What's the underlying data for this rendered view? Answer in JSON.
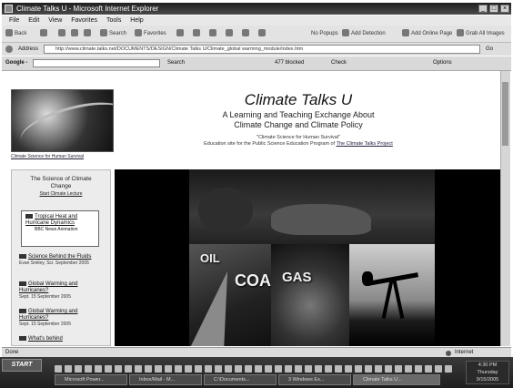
{
  "window": {
    "title": "Climate Talks U - Microsoft Internet Explorer"
  },
  "menu": [
    "File",
    "Edit",
    "View",
    "Favorites",
    "Tools",
    "Help"
  ],
  "toolbar": {
    "back_label": "Back",
    "search_label": "Search",
    "favorites_label": "Favorites",
    "no_popups_label": "No Popups",
    "add_detection_label": "Add Detection",
    "add_online_page_label": "Add Online Page",
    "grab_label": "Grab All Images"
  },
  "address": {
    "label": "Address",
    "url": "http://www.climate.talks.net/DOCUMENTS/DESIGN/Climate Talks U/Climate_global warming_module/index.htm",
    "go_label": "Go"
  },
  "google": {
    "label": "Google -",
    "search_label": "Search",
    "blocked_label": "477 blocked",
    "check_label": "Check",
    "options_label": "Options"
  },
  "page": {
    "site_title": "Climate Talks U",
    "subtitle_1": "A Learning and Teaching Exchange About",
    "subtitle_2": "Climate Change and Climate Policy",
    "small_1": "\"Climate Science for Human Survival\"",
    "small_2": "Education site for the Public Science Education Program of",
    "small_link": "The Climate Talks Project",
    "earth_caption": "Climate Science for Human Survival"
  },
  "sidebar": {
    "heading_1": "The Science of Climate",
    "heading_2": "Change",
    "heading_link": "Start Climate Lecture",
    "box": {
      "title": "Tropical Heat and Hurricane Dynamics",
      "meta": "BBC News Animation"
    },
    "items": [
      {
        "title": "Science Behind the Fluids",
        "meta": "Evan Smiley, Sci. September 2005"
      },
      {
        "title": "Global Warming and Hurricanes?",
        "meta": "Sept. 15 September 2005"
      },
      {
        "title": "Global Warming and Hurricanes?",
        "meta": "Sept. 15 September 2005"
      },
      {
        "title": "What's behind",
        "meta": ""
      }
    ]
  },
  "banner": {
    "words": [
      "OIL",
      "COAL",
      "GAS"
    ]
  },
  "statusbar": {
    "left": "Done",
    "right": "Internet"
  },
  "taskbar": {
    "start_label": "START",
    "tasks": [
      "Microsoft Power...",
      "Inbox/Mail - M...",
      "C:\\Documents...",
      "3 Windows Ex...",
      "Climate Talks U..."
    ],
    "clock_1": "4:30 PM",
    "clock_2": "Thursday",
    "clock_3": "9/15/2005"
  },
  "colors": {
    "titlebar": "#2f2f2f",
    "banner_bg": "#000000",
    "page_bg": "#ffffff"
  }
}
